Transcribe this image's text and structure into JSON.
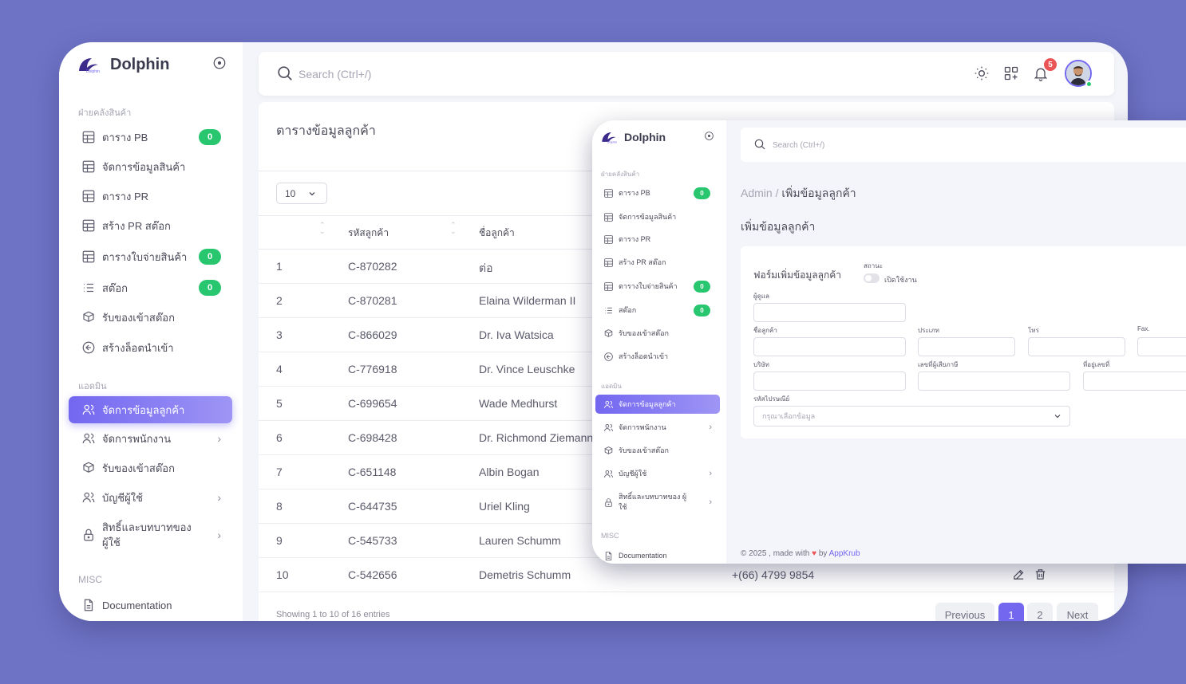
{
  "brand": {
    "name": "Dolphin",
    "logo_text": "Dolphin"
  },
  "sidebar": {
    "section_inventory": "ฝ่ายคลังสินค้า",
    "section_admin": "แอดมิน",
    "section_misc": "MISC",
    "items": [
      {
        "label": "ตาราง PB",
        "badge": "0",
        "icon": "table-icon"
      },
      {
        "label": "จัดการข้อมูลสินค้า",
        "icon": "table-icon"
      },
      {
        "label": "ตาราง PR",
        "icon": "table-icon"
      },
      {
        "label": "สร้าง PR สต๊อก",
        "icon": "table-icon"
      },
      {
        "label": "ตารางใบจ่ายสินค้า",
        "badge": "0",
        "icon": "table-icon"
      },
      {
        "label": "สต๊อก",
        "badge": "0",
        "icon": "list-icon"
      },
      {
        "label": "รับของเข้าสต๊อก",
        "icon": "box-icon"
      },
      {
        "label": "สร้างล็อตนำเข้า",
        "icon": "arrow-circle-left-icon"
      },
      {
        "label": "จัดการข้อมูลลูกค้า",
        "icon": "users-icon",
        "active": true
      },
      {
        "label": "จัดการพนักงาน",
        "icon": "users-icon",
        "chevron": "›"
      },
      {
        "label": "รับของเข้าสต๊อก",
        "icon": "box-icon"
      },
      {
        "label": "บัญชีผู้ใช้",
        "icon": "users-icon",
        "chevron": "›"
      },
      {
        "label": "สิทธิ์และบทบาทของ ผู้ใช้",
        "icon": "lock-icon",
        "chevron": "›"
      },
      {
        "label": "Documentation",
        "icon": "document-icon"
      }
    ]
  },
  "topbar": {
    "search_placeholder": "Search (Ctrl+/)",
    "notification_count": "5"
  },
  "table": {
    "title": "ตารางข้อมูลลูกค้า",
    "page_size": "10",
    "columns": [
      "รหัสลูกค้า",
      "ชื่อลูกค้า"
    ],
    "rows": [
      {
        "no": "1",
        "code": "C-870282",
        "name": "ต่อ"
      },
      {
        "no": "2",
        "code": "C-870281",
        "name": "Elaina Wilderman II"
      },
      {
        "no": "3",
        "code": "C-866029",
        "name": "Dr. Iva Watsica"
      },
      {
        "no": "4",
        "code": "C-776918",
        "name": "Dr. Vince Leuschke"
      },
      {
        "no": "5",
        "code": "C-699654",
        "name": "Wade Medhurst"
      },
      {
        "no": "6",
        "code": "C-698428",
        "name": "Dr. Richmond Ziemann"
      },
      {
        "no": "7",
        "code": "C-651148",
        "name": "Albin Bogan"
      },
      {
        "no": "8",
        "code": "C-644735",
        "name": "Uriel Kling"
      },
      {
        "no": "9",
        "code": "C-545733",
        "name": "Lauren Schumm"
      },
      {
        "no": "10",
        "code": "C-542656",
        "name": "Demetris Schumm",
        "phone": "+(66) 4799 9854"
      }
    ],
    "entries_info": "Showing 1 to 10 of 16 entries",
    "pagination": {
      "previous": "Previous",
      "pages": [
        "1",
        "2"
      ],
      "next": "Next"
    }
  },
  "overlay": {
    "brand": "Dolphin",
    "search_placeholder": "Search (Ctrl+/)",
    "breadcrumb_parent": "Admin /",
    "breadcrumb_current": "เพิ่มข้อมูลลูกค้า",
    "heading": "เพิ่มข้อมูลลูกค้า",
    "sidebar": {
      "section_inventory": "ฝ่ายคลังสินค้า",
      "section_admin": "แอดมิน",
      "section_misc": "MISC",
      "items": [
        {
          "label": "ตาราง PB",
          "badge": "0"
        },
        {
          "label": "จัดการข้อมูลสินค้า"
        },
        {
          "label": "ตาราง PR"
        },
        {
          "label": "สร้าง PR สต๊อก"
        },
        {
          "label": "ตารางใบจ่ายสินค้า",
          "badge": "0"
        },
        {
          "label": "สต๊อก",
          "badge": "0"
        },
        {
          "label": "รับของเข้าสต๊อก"
        },
        {
          "label": "สร้างล็อตนำเข้า"
        },
        {
          "label": "จัดการข้อมูลลูกค้า",
          "active": true
        },
        {
          "label": "จัดการพนักงาน",
          "chevron": "›"
        },
        {
          "label": "รับของเข้าสต๊อก"
        },
        {
          "label": "บัญชีผู้ใช้",
          "chevron": "›"
        },
        {
          "label": "สิทธิ์และบทบาทของ ผู้ใช้",
          "chevron": "›"
        },
        {
          "label": "Documentation"
        }
      ]
    },
    "form": {
      "title": "ฟอร์มเพิ่มข้อมูลลูกค้า",
      "status_label": "สถานะ",
      "status_toggle_label": "เปิดใช้งาน",
      "status_on": false,
      "fields": {
        "caretaker": "ผู้ดูแล",
        "customer_name": "ชื่อลูกค้า",
        "type": "ประเภท",
        "phone": "โทร",
        "fax": "Fax.",
        "company": "บริษัท",
        "tax_id": "เลขที่ผู้เสียภาษี",
        "address_no": "ที่อยู่เลขที่",
        "postal_code": "รหัสไปรษณีย์"
      },
      "select_placeholder": "กรุณาเลือกข้อมูล"
    },
    "footer": {
      "text": "© 2025 , made with",
      "by": "by",
      "link": "AppKrub"
    }
  },
  "colors": {
    "primary": "#7367f0",
    "success": "#28c76f",
    "danger": "#ea5455",
    "background": "#6f73c6"
  }
}
